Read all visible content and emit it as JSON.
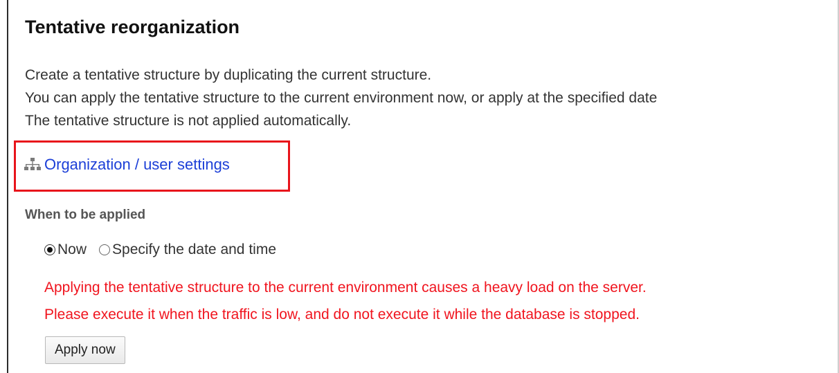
{
  "title": "Tentative reorganization",
  "description": [
    "Create a tentative structure by duplicating the current structure.",
    "You can apply the tentative structure to the current environment now, or apply at the specified date",
    "The tentative structure is not applied automatically."
  ],
  "org_link": {
    "label": "Organization / user settings",
    "icon": "org-chart-icon"
  },
  "when_applied": {
    "label": "When to be applied",
    "options": [
      {
        "label": "Now",
        "selected": true
      },
      {
        "label": "Specify the date and time",
        "selected": false
      }
    ]
  },
  "warning": [
    "Applying the tentative structure to the current environment causes a heavy load on the server.",
    "Please execute it when the traffic is low, and do not execute it while the database is stopped."
  ],
  "apply_button": "Apply now",
  "colors": {
    "link": "#1c3fd7",
    "warning": "#f0141e",
    "highlight": "#e8141b"
  }
}
